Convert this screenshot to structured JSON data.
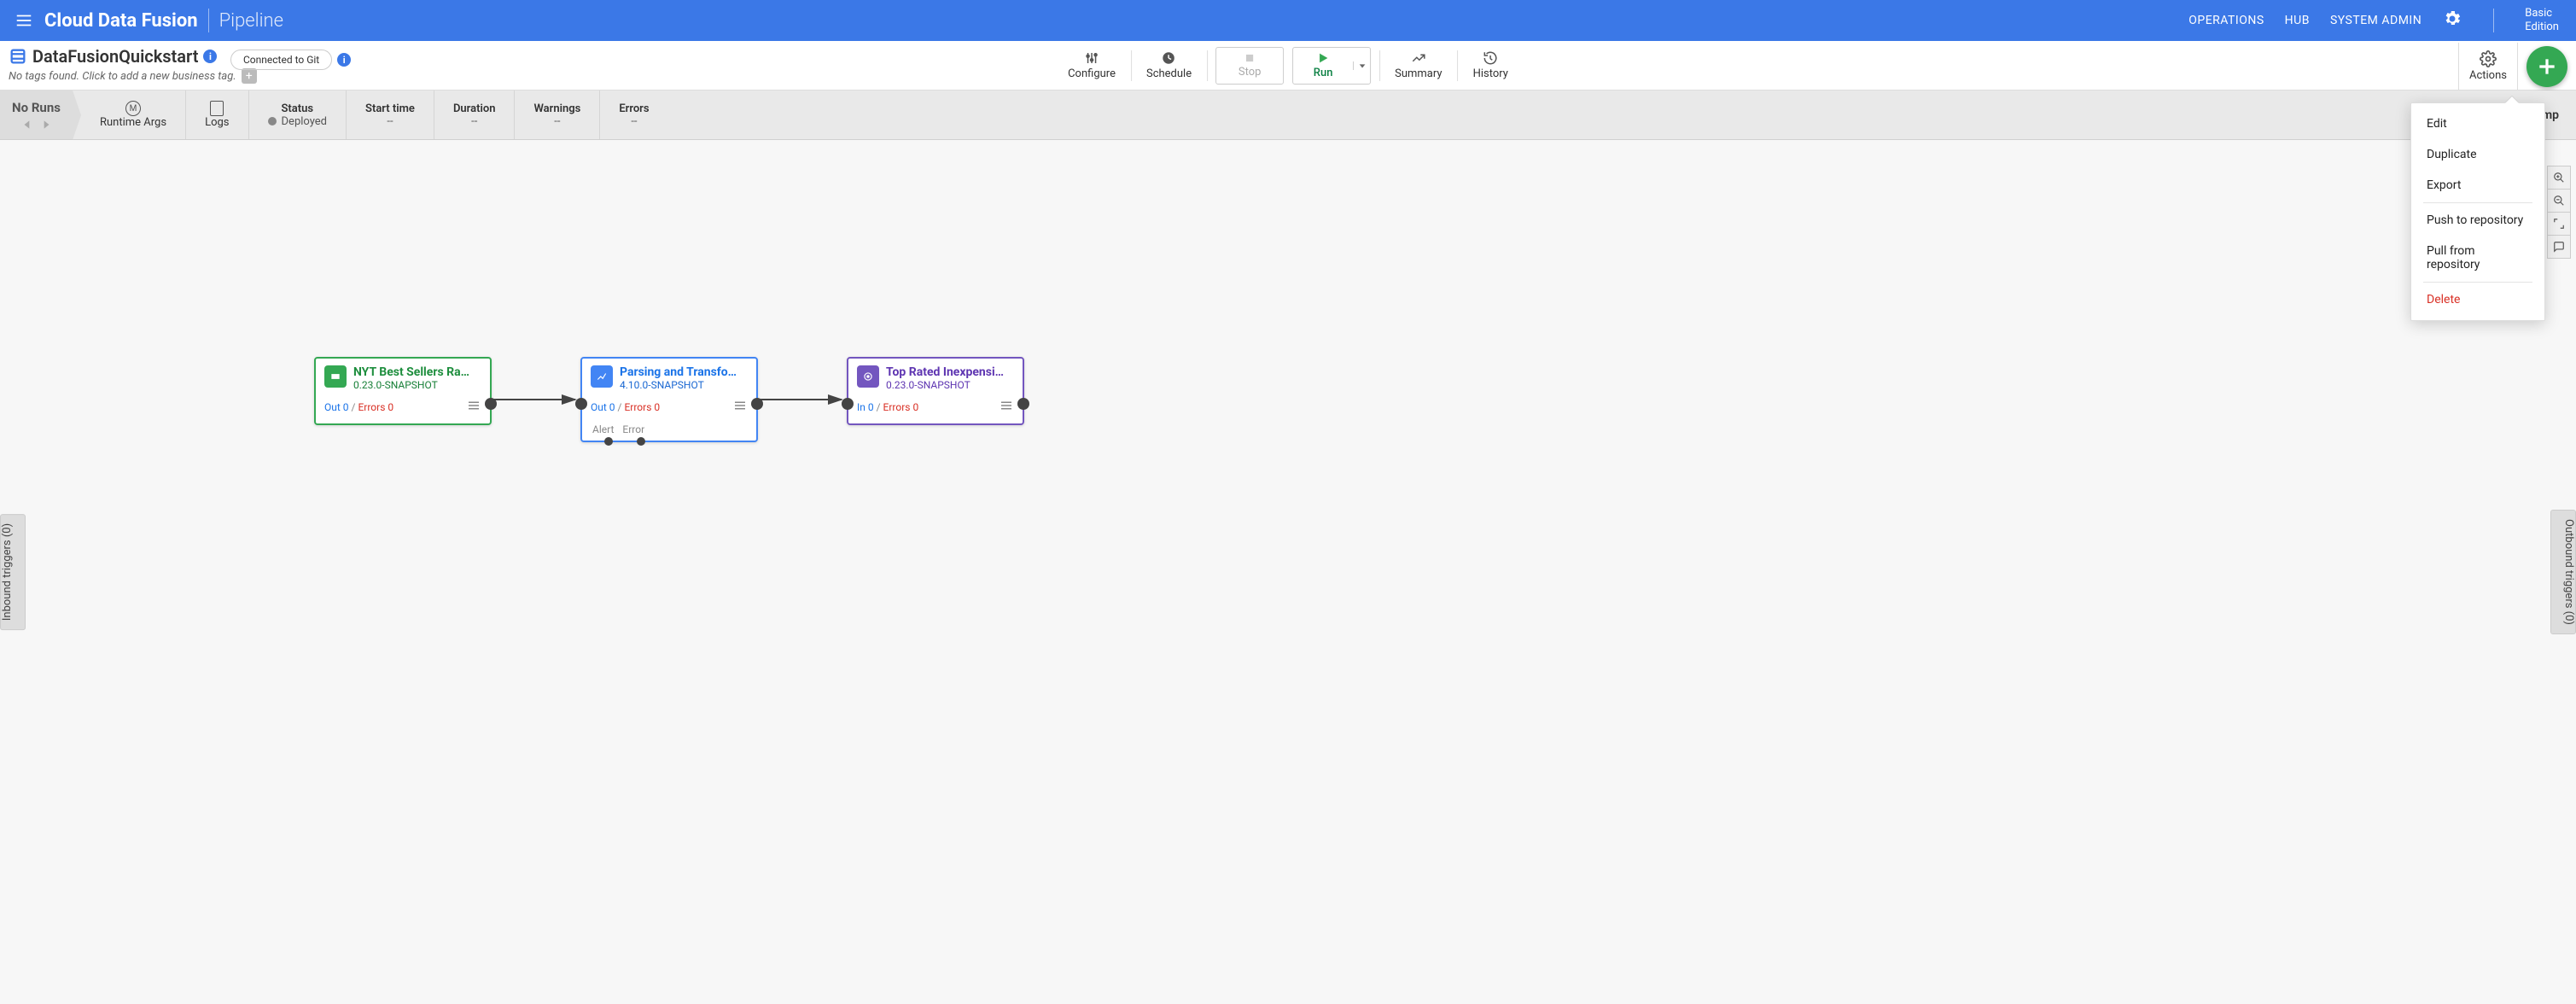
{
  "header": {
    "brand": "Cloud Data Fusion",
    "section": "Pipeline",
    "nav": {
      "operations": "OPERATIONS",
      "hub": "HUB",
      "sysadmin": "SYSTEM ADMIN"
    },
    "edition_line1": "Basic",
    "edition_line2": "Edition"
  },
  "pipeline": {
    "name": "DataFusionQuickstart",
    "tag_prompt": "No tags found. Click to add a new business tag.",
    "git_status": "Connected to Git"
  },
  "toolbar": {
    "configure": "Configure",
    "schedule": "Schedule",
    "stop": "Stop",
    "run": "Run",
    "summary": "Summary",
    "history": "History",
    "actions": "Actions"
  },
  "runstrip": {
    "no_runs": "No Runs",
    "runtime_args": "Runtime Args",
    "logs": "Logs",
    "status_h": "Status",
    "status_v": "Deployed",
    "start_h": "Start time",
    "start_v": "--",
    "duration_h": "Duration",
    "duration_v": "--",
    "warnings_h": "Warnings",
    "warnings_v": "--",
    "errors_h": "Errors",
    "errors_v": "--",
    "right_label": "Comp"
  },
  "actions_menu": {
    "edit": "Edit",
    "duplicate": "Duplicate",
    "export": "Export",
    "push": "Push to repository",
    "pull": "Pull from repository",
    "delete": "Delete"
  },
  "side": {
    "inbound": "Inbound triggers (0)",
    "outbound": "Outbound triggers (0)"
  },
  "nodes": {
    "n1": {
      "title": "NYT Best Sellers Ra…",
      "version": "0.23.0-SNAPSHOT",
      "out": "Out 0",
      "err": "Errors 0"
    },
    "n2": {
      "title": "Parsing and Transfo…",
      "version": "4.10.0-SNAPSHOT",
      "out": "Out 0",
      "err": "Errors 0",
      "alert": "Alert",
      "error": "Error"
    },
    "n3": {
      "title": "Top Rated Inexpensi…",
      "version": "0.23.0-SNAPSHOT",
      "in": "In 0",
      "err": "Errors 0"
    }
  }
}
